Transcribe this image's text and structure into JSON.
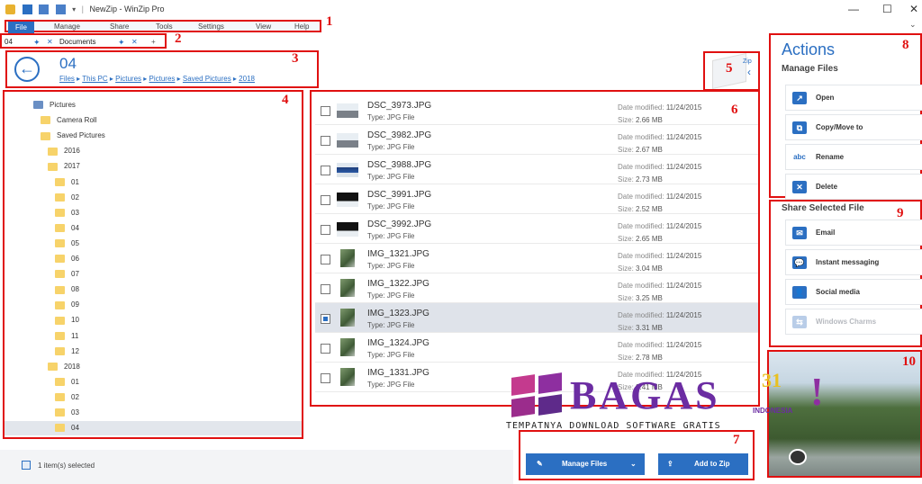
{
  "window": {
    "title": "NewZip - WinZip Pro",
    "minimize": "—",
    "maximize": "☐",
    "close": "✕"
  },
  "menu": [
    "File",
    "Manage",
    "Share",
    "Tools",
    "Settings",
    "View",
    "Help"
  ],
  "tabs": {
    "first": "04",
    "second": "Documents",
    "add": "+"
  },
  "address": {
    "title": "04",
    "crumbs": [
      "Files",
      "This PC",
      "Pictures",
      "Pictures",
      "Saved Pictures",
      "2018"
    ]
  },
  "zip_label": "Zip",
  "tree": [
    {
      "label": "Pictures",
      "level": 0,
      "root": true
    },
    {
      "label": "Camera Roll",
      "level": 1
    },
    {
      "label": "Saved Pictures",
      "level": 1
    },
    {
      "label": "2016",
      "level": 2
    },
    {
      "label": "2017",
      "level": 2
    },
    {
      "label": "01",
      "level": 3
    },
    {
      "label": "02",
      "level": 3
    },
    {
      "label": "03",
      "level": 3
    },
    {
      "label": "04",
      "level": 3
    },
    {
      "label": "05",
      "level": 3
    },
    {
      "label": "06",
      "level": 3
    },
    {
      "label": "07",
      "level": 3
    },
    {
      "label": "08",
      "level": 3
    },
    {
      "label": "09",
      "level": 3
    },
    {
      "label": "10",
      "level": 3
    },
    {
      "label": "11",
      "level": 3
    },
    {
      "label": "12",
      "level": 3
    },
    {
      "label": "2018",
      "level": 2
    },
    {
      "label": "01",
      "level": 3
    },
    {
      "label": "02",
      "level": 3
    },
    {
      "label": "03",
      "level": 3
    },
    {
      "label": "04",
      "level": 3,
      "selected": true
    }
  ],
  "files": [
    {
      "name": "DSC_3973.JPG",
      "type": "Type: JPG File",
      "date": "11/24/2015",
      "size": "2.66 MB",
      "thumb": "snow"
    },
    {
      "name": "DSC_3982.JPG",
      "type": "Type: JPG File",
      "date": "11/24/2015",
      "size": "2.67 MB",
      "thumb": "snow"
    },
    {
      "name": "DSC_3988.JPG",
      "type": "Type: JPG File",
      "date": "11/24/2015",
      "size": "2.73 MB",
      "thumb": "blue"
    },
    {
      "name": "DSC_3991.JPG",
      "type": "Type: JPG File",
      "date": "11/24/2015",
      "size": "2.52 MB",
      "thumb": "dark"
    },
    {
      "name": "DSC_3992.JPG",
      "type": "Type: JPG File",
      "date": "11/24/2015",
      "size": "2.65 MB",
      "thumb": "dark"
    },
    {
      "name": "IMG_1321.JPG",
      "type": "Type: JPG File",
      "date": "11/24/2015",
      "size": "3.04 MB",
      "thumb": "forest"
    },
    {
      "name": "IMG_1322.JPG",
      "type": "Type: JPG File",
      "date": "11/24/2015",
      "size": "3.25 MB",
      "thumb": "forest"
    },
    {
      "name": "IMG_1323.JPG",
      "type": "Type: JPG File",
      "date": "11/24/2015",
      "size": "3.31 MB",
      "thumb": "forest",
      "selected": true
    },
    {
      "name": "IMG_1324.JPG",
      "type": "Type: JPG File",
      "date": "11/24/2015",
      "size": "2.78 MB",
      "thumb": "forest"
    },
    {
      "name": "IMG_1331.JPG",
      "type": "Type: JPG File",
      "date": "11/24/2015",
      "size": "2.41 MB",
      "thumb": "forest"
    }
  ],
  "date_label": "Date modified:",
  "size_label": "Size:",
  "actions": {
    "title": "Actions",
    "subtitle": "Manage Files",
    "items": [
      "Open",
      "Copy/Move to",
      "Rename",
      "Delete"
    ]
  },
  "share": {
    "title": "Share Selected File",
    "items": [
      "Email",
      "Instant messaging",
      "Social media",
      "Windows Charms"
    ]
  },
  "status": "1 item(s) selected",
  "buttons": {
    "manage": "Manage Files",
    "add": "Add to Zip"
  },
  "callouts": [
    "1",
    "2",
    "3",
    "4",
    "5",
    "6",
    "7",
    "8",
    "9",
    "10"
  ],
  "watermark": {
    "brand": "BAGAS",
    "number": "31",
    "country": "INDONESIA",
    "tagline": "TEMPATNYA DOWNLOAD SOFTWARE GRATIS"
  }
}
